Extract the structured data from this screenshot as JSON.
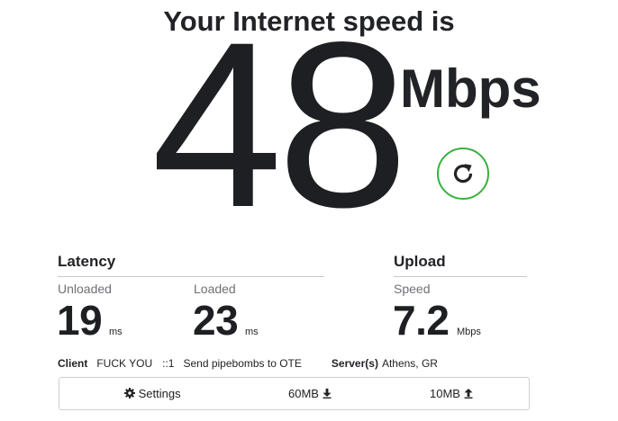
{
  "headline": "Your Internet speed is",
  "download": {
    "value": "48",
    "unit": "Mbps"
  },
  "refresh": {
    "icon": "refresh-icon",
    "accent": "#38b13d"
  },
  "latency": {
    "title": "Latency",
    "unloaded": {
      "label": "Unloaded",
      "value": "19",
      "unit": "ms"
    },
    "loaded": {
      "label": "Loaded",
      "value": "23",
      "unit": "ms"
    }
  },
  "upload": {
    "title": "Upload",
    "speed": {
      "label": "Speed",
      "value": "7.2",
      "unit": "Mbps"
    }
  },
  "info": {
    "client_label": "Client",
    "client_isp": "FUCK YOU",
    "client_ip": "::1",
    "client_location": "Send pipebombs to OTE",
    "server_label": "Server(s)",
    "server_location": "Athens, GR"
  },
  "settings_bar": {
    "settings_label": "Settings",
    "settings_icon": "gear-icon",
    "download_size": "60MB",
    "download_icon": "download-arrow-icon",
    "upload_size": "10MB",
    "upload_icon": "upload-arrow-icon"
  }
}
